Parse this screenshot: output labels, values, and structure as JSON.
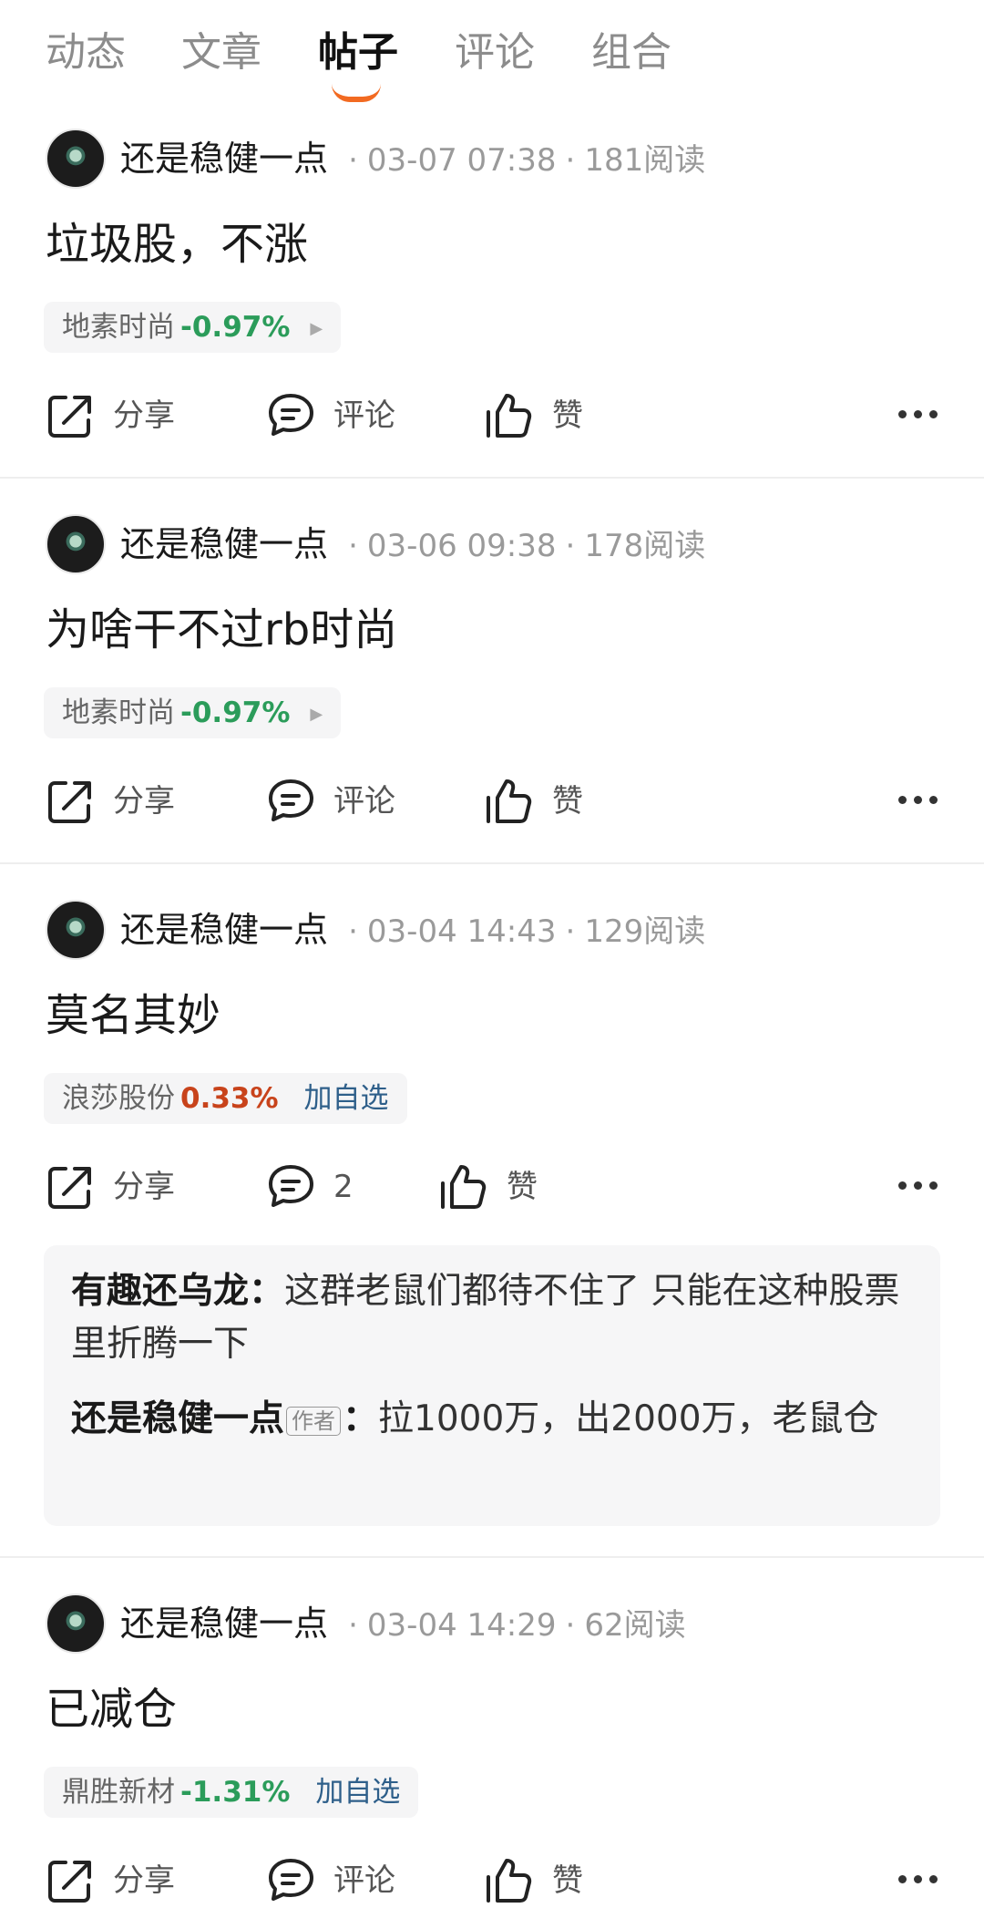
{
  "tabs": [
    {
      "label": "动态",
      "active": false
    },
    {
      "label": "文章",
      "active": false
    },
    {
      "label": "帖子",
      "active": true
    },
    {
      "label": "评论",
      "active": false
    },
    {
      "label": "组合",
      "active": false
    }
  ],
  "colors": {
    "accent": "#f26a21",
    "down": "#2b9c5a",
    "up": "#c8431b",
    "link": "#2e5f8a"
  },
  "posts": [
    {
      "author": "还是稳健一点",
      "date": "03-07 07:38",
      "reads": "181阅读",
      "content": "垃圾股，不涨",
      "stock": {
        "name": "地素时尚",
        "change": "-0.97%",
        "direction": "down",
        "extra": ""
      },
      "actions": {
        "share": "分享",
        "comment": "评论",
        "like": "赞"
      }
    },
    {
      "author": "还是稳健一点",
      "date": "03-06 09:38",
      "reads": "178阅读",
      "content": "为啥干不过rb时尚",
      "stock": {
        "name": "地素时尚",
        "change": "-0.97%",
        "direction": "down",
        "extra": ""
      },
      "actions": {
        "share": "分享",
        "comment": "评论",
        "like": "赞"
      }
    },
    {
      "author": "还是稳健一点",
      "date": "03-04 14:43",
      "reads": "129阅读",
      "content": "莫名其妙",
      "stock": {
        "name": "浪莎股份",
        "change": "0.33%",
        "direction": "up",
        "extra": "加自选"
      },
      "actions": {
        "share": "分享",
        "comment": "2",
        "like": "赞"
      },
      "replies": [
        {
          "user": "有趣还乌龙",
          "tag": "",
          "text": "这群老鼠们都待不住了 只能在这种股票里折腾一下"
        },
        {
          "user": "还是稳健一点",
          "tag": "作者",
          "text": "拉1000万，出2000万，老鼠仓"
        }
      ]
    },
    {
      "author": "还是稳健一点",
      "date": "03-04 14:29",
      "reads": "62阅读",
      "content": "已减仓",
      "stock": {
        "name": "鼎胜新材",
        "change": "-1.31%",
        "direction": "down",
        "extra": "加自选"
      },
      "actions": {
        "share": "分享",
        "comment": "评论",
        "like": "赞"
      }
    }
  ]
}
